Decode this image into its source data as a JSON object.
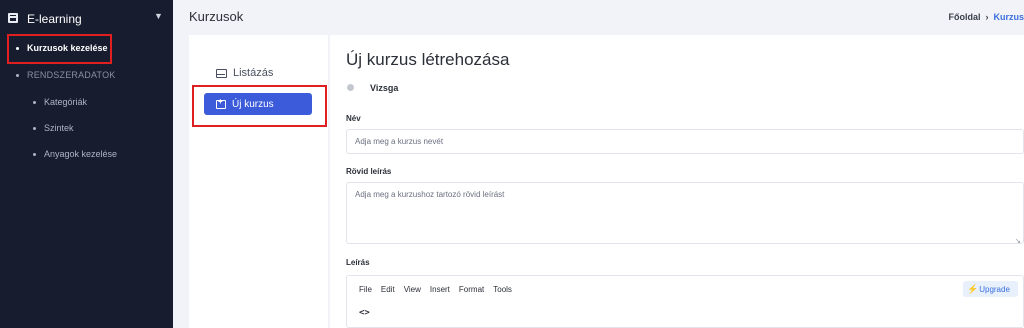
{
  "sidebar": {
    "app_title": "E-learning",
    "items": [
      {
        "label": "Kurzusok kezelése"
      },
      {
        "label": "RENDSZERADATOK"
      },
      {
        "label": "Kategóriák"
      },
      {
        "label": "Szintek"
      },
      {
        "label": "Anyagok kezelése"
      }
    ]
  },
  "header": {
    "title": "Kurzusok",
    "breadcrumb": {
      "home": "Főoldal",
      "separator": "›",
      "current": "Kurzus"
    }
  },
  "left_nav": {
    "list_label": "Listázás",
    "new_label": "Új kurzus"
  },
  "form": {
    "title": "Új kurzus létrehozása",
    "toggle_label": "Vizsga",
    "name_label": "Név",
    "name_placeholder": "Adja meg a kurzus nevét",
    "short_label": "Rövid leírás",
    "short_placeholder": "Adja meg a kurzushoz tartozó rövid leírást",
    "desc_label": "Leírás"
  },
  "editor": {
    "menu": [
      "File",
      "Edit",
      "View",
      "Insert",
      "Format",
      "Tools"
    ],
    "upgrade_label": "Upgrade",
    "code_icon": "<>"
  },
  "colors": {
    "sidebar_bg": "#181c2f",
    "accent": "#3b5bdb",
    "link": "#3b6fe0",
    "highlight_box": "#e02020"
  },
  "icons": {
    "app": "window-icon",
    "list": "inbox-icon",
    "new": "add-folder-icon",
    "upgrade": "lightning-icon",
    "code": "code-icon"
  }
}
